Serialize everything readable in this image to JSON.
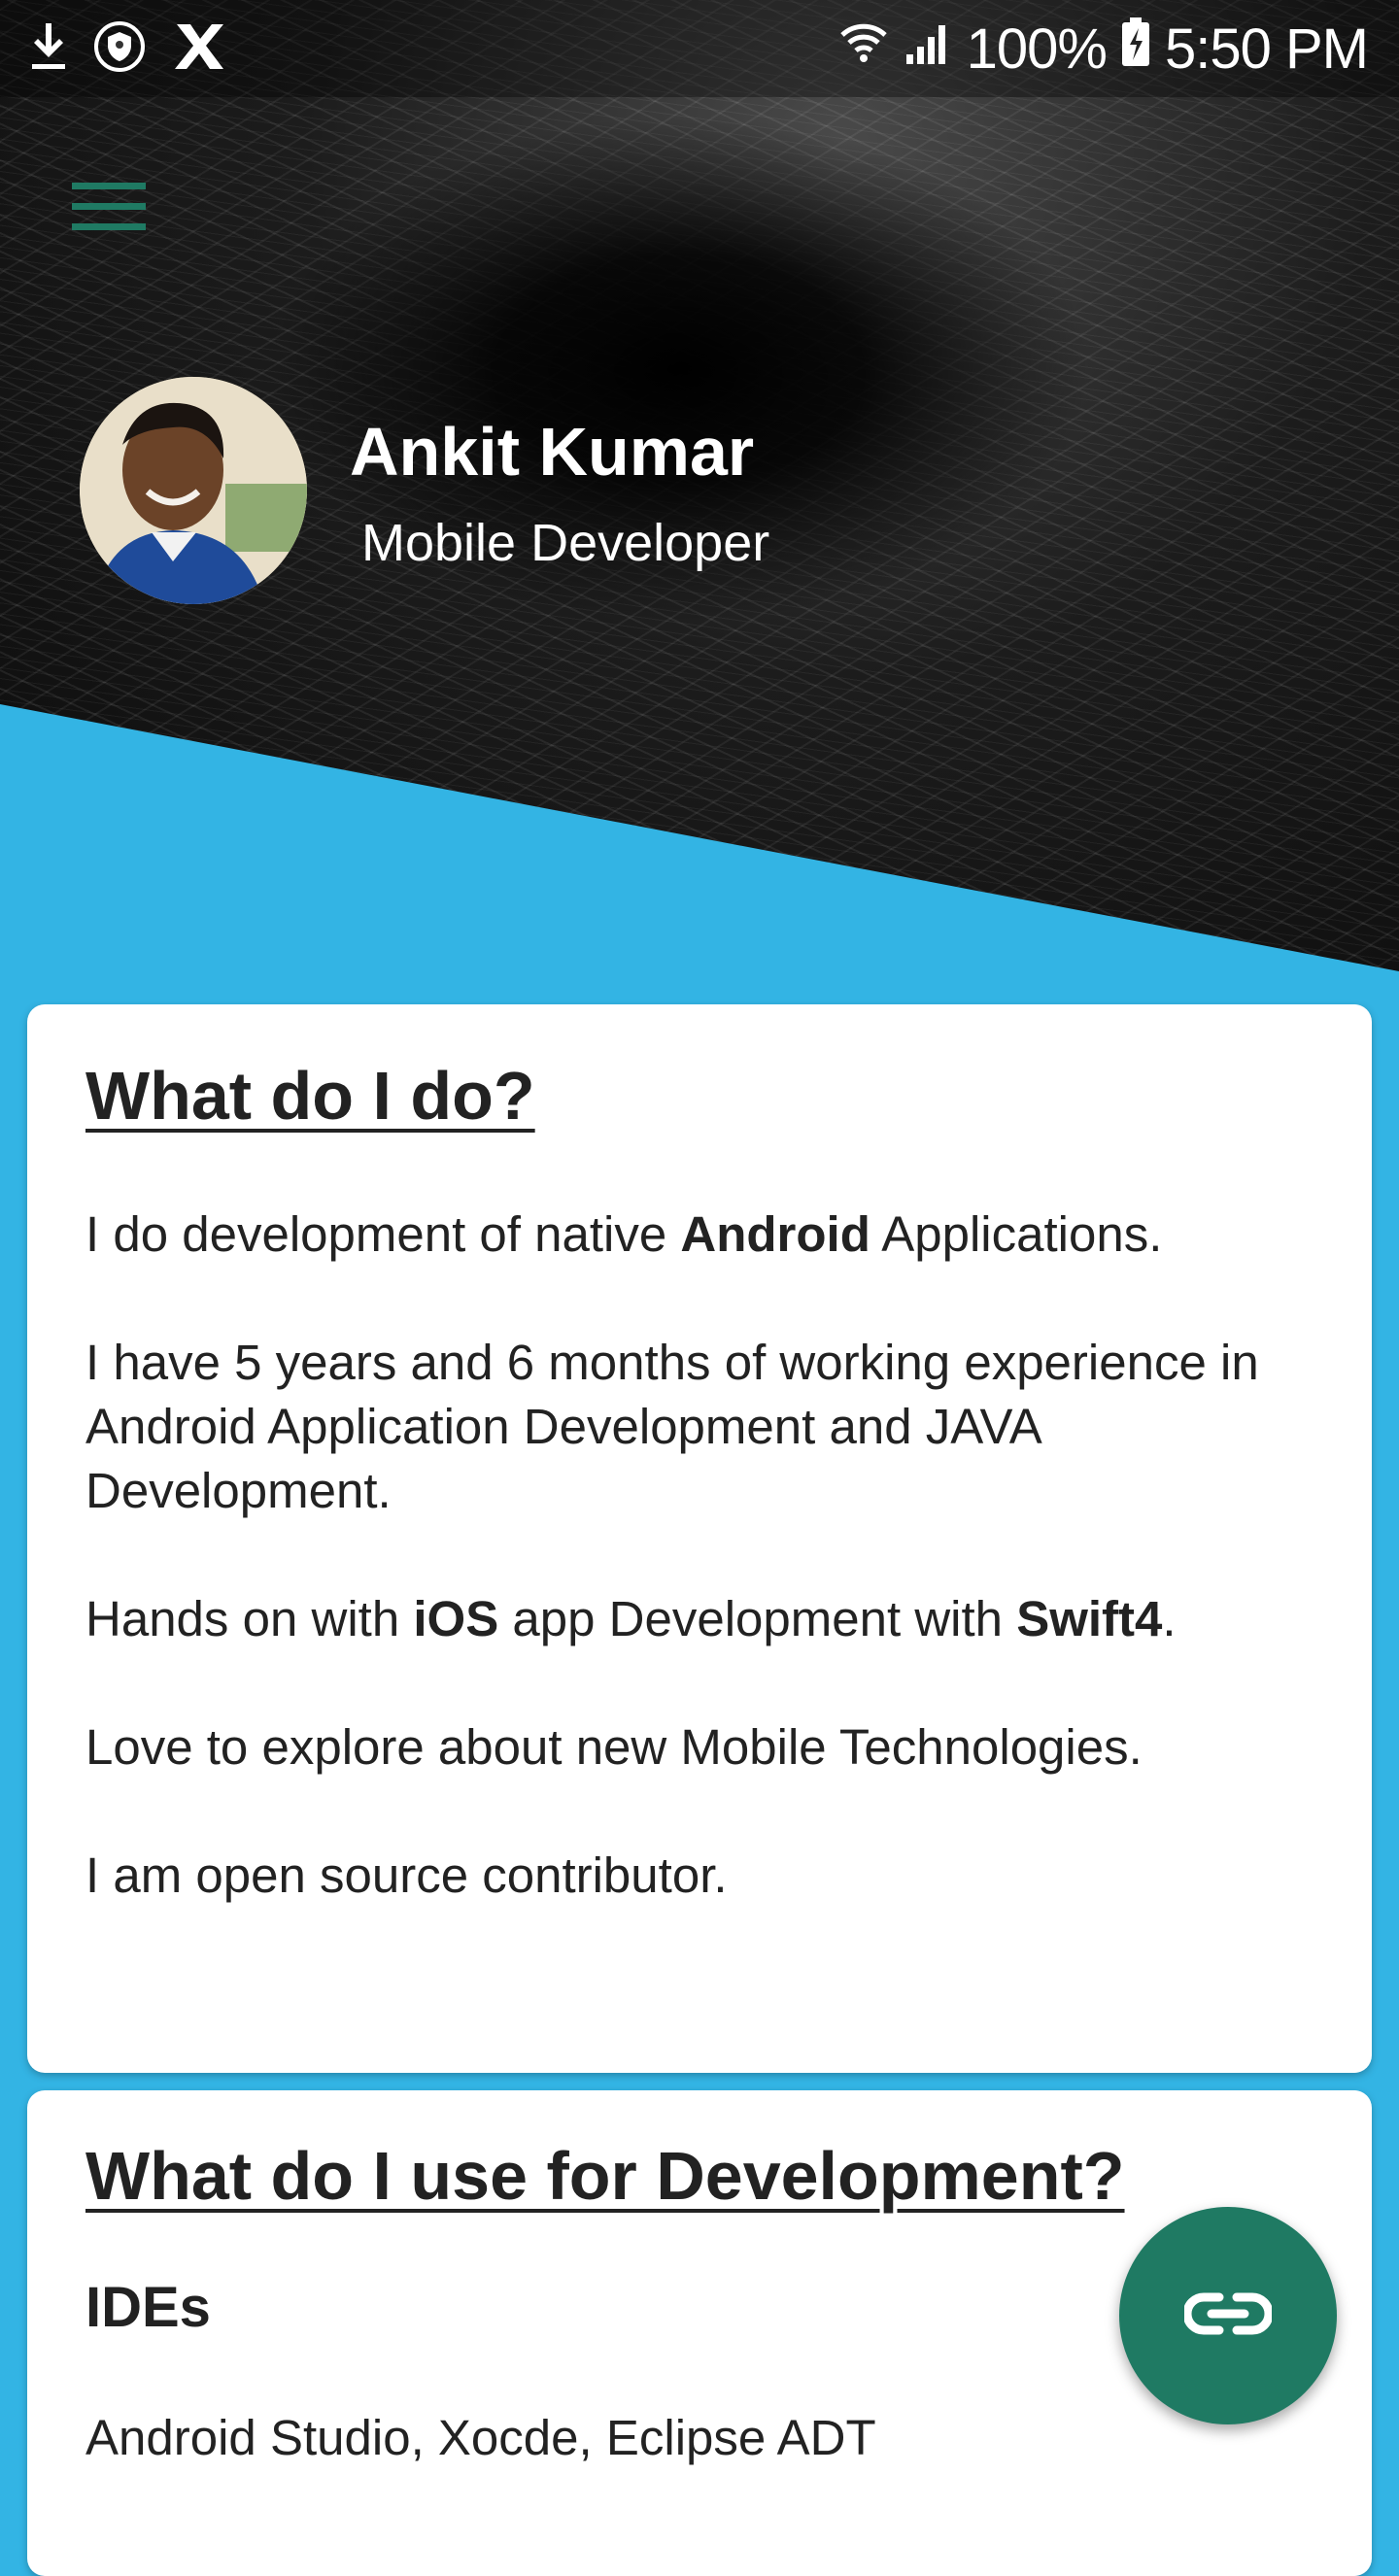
{
  "status_bar": {
    "battery": "100%",
    "time": "5:50 PM",
    "icons": [
      "download-icon",
      "shield-icon",
      "x-app-icon",
      "wifi-icon",
      "signal-icon",
      "battery-charging-icon"
    ]
  },
  "header": {
    "menu_icon": "hamburger-menu-icon",
    "name": "Ankit Kumar",
    "role": "Mobile Developer"
  },
  "about_card": {
    "title": "What do I do?",
    "p1": {
      "a": "I do development of native ",
      "b": "Android",
      "c": " Applications."
    },
    "p2": "I have 5 years and 6 months of working experience in Android Application Development and JAVA Development.",
    "p3": {
      "a": "Hands on with ",
      "b": "iOS",
      "c": " app Development with ",
      "d": "Swift4",
      "e": "."
    },
    "p4": "Love to explore about new Mobile Technologies.",
    "p5": "I am open source contributor."
  },
  "tools_card": {
    "title": "What do I use for Development?",
    "subheading": "IDEs",
    "ides": "Android Studio, Xocde, Eclipse ADT"
  },
  "fab": {
    "icon": "link-icon"
  },
  "colors": {
    "accent": "#1f7a63",
    "background": "#33b4e4",
    "card": "#ffffff",
    "text": "#222222"
  }
}
